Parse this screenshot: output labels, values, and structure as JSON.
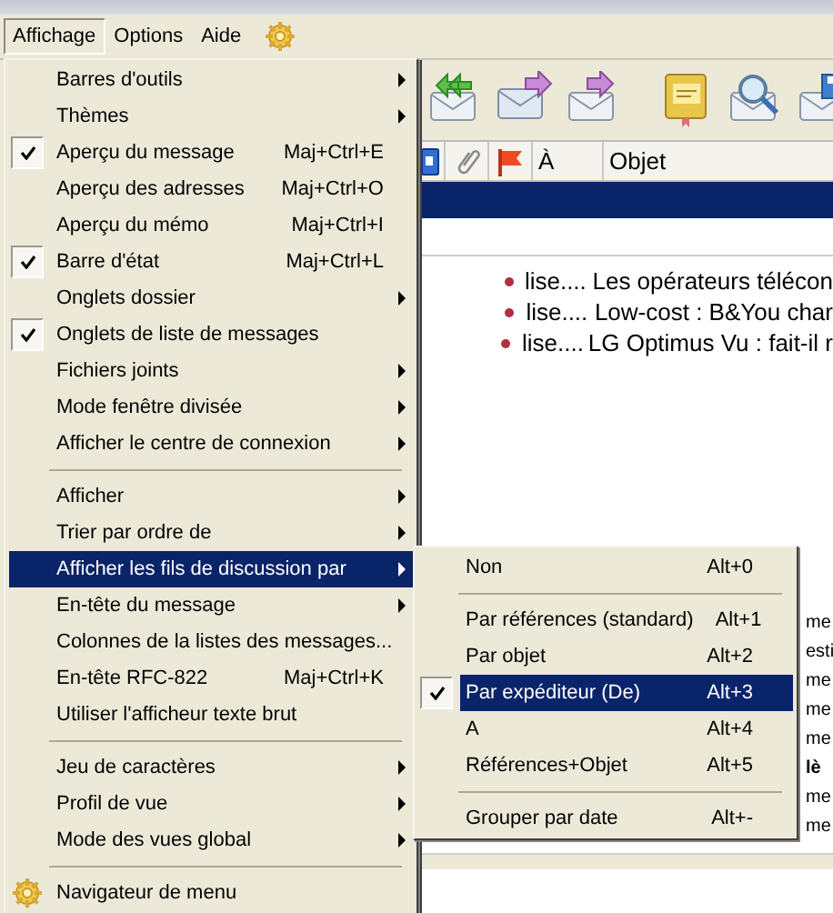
{
  "menu_bar": [
    {
      "label": "Affichage",
      "selected": true
    },
    {
      "label": "Options",
      "selected": false
    },
    {
      "label": "Aide",
      "selected": false
    }
  ],
  "toolbar": {
    "buttons": [
      {
        "kind": "reply-all"
      },
      {
        "kind": "forward"
      },
      {
        "kind": "redirect"
      },
      {
        "kind": "separator"
      },
      {
        "kind": "spelling"
      },
      {
        "kind": "find"
      },
      {
        "kind": "save"
      }
    ]
  },
  "message_list": {
    "columns": [
      {
        "kind": "icon-blue"
      },
      {
        "kind": "icon-clip"
      },
      {
        "kind": "icon-flag"
      },
      {
        "kind": "text",
        "label": "À"
      },
      {
        "kind": "text",
        "label": "Objet"
      }
    ],
    "rows": [
      {
        "to": "lise....",
        "subject": "Les opérateurs télécon"
      },
      {
        "to": "lise....",
        "subject": "Low-cost : B&You char"
      },
      {
        "to": "lise....",
        "subject": "LG Optimus Vu : fait-il r"
      }
    ],
    "column_fragments": [
      {
        "text": "me",
        "bold": false
      },
      {
        "text": "esti",
        "bold": false
      },
      {
        "text": "me",
        "bold": false
      },
      {
        "text": "me",
        "bold": false
      },
      {
        "text": "me",
        "bold": false
      },
      {
        "text": "lè",
        "bold": true
      },
      {
        "text": "me",
        "bold": false
      },
      {
        "text": "me",
        "bold": false
      }
    ]
  },
  "view_menu": [
    {
      "kind": "item",
      "label": "Barres d'outils",
      "submenu": true,
      "checked": false,
      "selected": false
    },
    {
      "kind": "item",
      "label": "Thèmes",
      "submenu": true,
      "checked": false,
      "selected": false
    },
    {
      "kind": "item",
      "label": "Aperçu du message",
      "shortcut": "Maj+Ctrl+E",
      "submenu": false,
      "checked": true,
      "selected": false
    },
    {
      "kind": "item",
      "label": "Aperçu des adresses",
      "shortcut": "Maj+Ctrl+O",
      "submenu": false,
      "checked": false,
      "selected": false
    },
    {
      "kind": "item",
      "label": "Aperçu du mémo",
      "shortcut": "Maj+Ctrl+I",
      "submenu": false,
      "checked": false,
      "selected": false
    },
    {
      "kind": "item",
      "label": "Barre d'état",
      "shortcut": "Maj+Ctrl+L",
      "submenu": false,
      "checked": true,
      "selected": false
    },
    {
      "kind": "item",
      "label": "Onglets dossier",
      "submenu": true,
      "checked": false,
      "selected": false
    },
    {
      "kind": "item",
      "label": "Onglets de liste de messages",
      "submenu": false,
      "checked": true,
      "selected": false
    },
    {
      "kind": "item",
      "label": "Fichiers joints",
      "submenu": true,
      "checked": false,
      "selected": false
    },
    {
      "kind": "item",
      "label": "Mode fenêtre divisée",
      "submenu": true,
      "checked": false,
      "selected": false
    },
    {
      "kind": "item",
      "label": "Afficher le centre de connexion",
      "submenu": true,
      "checked": false,
      "selected": false
    },
    {
      "kind": "separator"
    },
    {
      "kind": "item",
      "label": "Afficher",
      "submenu": true,
      "checked": false,
      "selected": false
    },
    {
      "kind": "item",
      "label": "Trier par ordre de",
      "submenu": true,
      "checked": false,
      "selected": false
    },
    {
      "kind": "item",
      "label": "Afficher les fils de discussion par",
      "submenu": true,
      "checked": false,
      "selected": true
    },
    {
      "kind": "item",
      "label": "En-tête du message",
      "submenu": true,
      "checked": false,
      "selected": false
    },
    {
      "kind": "item",
      "label": "Colonnes de la listes des messages...",
      "submenu": false,
      "checked": false,
      "selected": false
    },
    {
      "kind": "item",
      "label": "En-tête RFC-822",
      "shortcut": "Maj+Ctrl+K",
      "submenu": false,
      "checked": false,
      "selected": false
    },
    {
      "kind": "item",
      "label": "Utiliser l'afficheur texte brut",
      "submenu": false,
      "checked": false,
      "selected": false
    },
    {
      "kind": "separator"
    },
    {
      "kind": "item",
      "label": "Jeu de caractères",
      "submenu": true,
      "checked": false,
      "selected": false
    },
    {
      "kind": "item",
      "label": "Profil de vue",
      "submenu": true,
      "checked": false,
      "selected": false
    },
    {
      "kind": "item",
      "label": "Mode des vues global",
      "submenu": true,
      "checked": false,
      "selected": false
    },
    {
      "kind": "separator"
    },
    {
      "kind": "gear-item",
      "label": "Navigateur de menu",
      "submenu": false,
      "checked": false,
      "selected": false
    }
  ],
  "threads_submenu": [
    {
      "kind": "item",
      "label": "Non",
      "shortcut": "Alt+0",
      "checked": false,
      "selected": false
    },
    {
      "kind": "separator"
    },
    {
      "kind": "item",
      "label": "Par références (standard)",
      "shortcut": "Alt+1",
      "checked": false,
      "selected": false
    },
    {
      "kind": "item",
      "label": "Par objet",
      "shortcut": "Alt+2",
      "checked": false,
      "selected": false
    },
    {
      "kind": "item",
      "label": "Par expéditeur (De)",
      "shortcut": "Alt+3",
      "checked": true,
      "selected": true
    },
    {
      "kind": "item",
      "label": "A",
      "shortcut": "Alt+4",
      "checked": false,
      "selected": false
    },
    {
      "kind": "item",
      "label": "Références+Objet",
      "shortcut": "Alt+5",
      "checked": false,
      "selected": false
    },
    {
      "kind": "separator"
    },
    {
      "kind": "item",
      "label": "Grouper par date",
      "shortcut": "Alt+-",
      "checked": false,
      "selected": false
    }
  ]
}
